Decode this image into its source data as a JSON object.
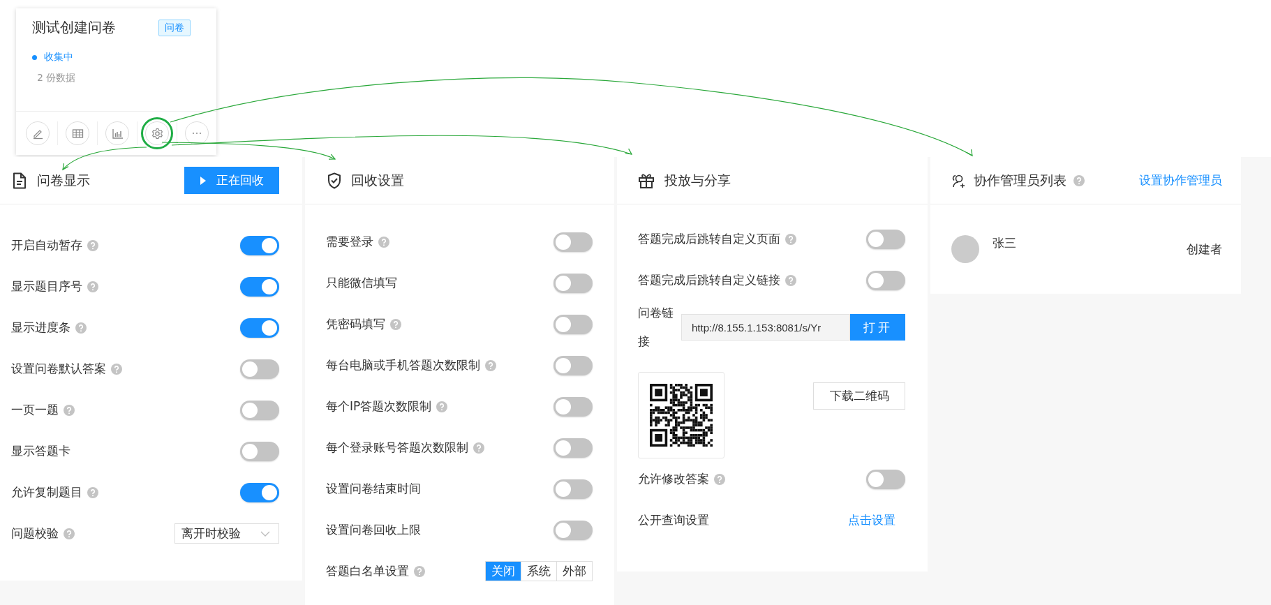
{
  "card": {
    "title": "测试创建问卷",
    "tag": "问卷",
    "status": "收集中",
    "count": "2 份数据",
    "actions": [
      {
        "kind": "edit",
        "highlighted": false
      },
      {
        "kind": "table",
        "highlighted": false
      },
      {
        "kind": "chart",
        "highlighted": false
      },
      {
        "kind": "settings",
        "highlighted": true
      },
      {
        "kind": "more",
        "highlighted": false
      }
    ]
  },
  "display_panel": {
    "title": "问卷显示",
    "button": "正在回收",
    "settings": [
      {
        "kind": "switch",
        "label": "开启自动暂存",
        "help": true,
        "on": true
      },
      {
        "kind": "switch",
        "label": "显示题目序号",
        "help": true,
        "on": true
      },
      {
        "kind": "switch",
        "label": "显示进度条",
        "help": true,
        "on": true
      },
      {
        "kind": "switch",
        "label": "设置问卷默认答案",
        "help": true,
        "on": false
      },
      {
        "kind": "switch",
        "label": "一页一题",
        "help": true,
        "on": false
      },
      {
        "kind": "switch",
        "label": "显示答题卡",
        "help": false,
        "on": false
      },
      {
        "kind": "switch",
        "label": "允许复制题目",
        "help": true,
        "on": true
      },
      {
        "kind": "select",
        "label": "问题校验",
        "help": true,
        "value": "离开时校验"
      }
    ]
  },
  "collection_panel": {
    "title": "回收设置",
    "settings": [
      {
        "kind": "switch",
        "label": "需要登录",
        "help": true,
        "on": false
      },
      {
        "kind": "switch",
        "label": "只能微信填写",
        "help": false,
        "on": false
      },
      {
        "kind": "switch",
        "label": "凭密码填写",
        "help": true,
        "on": false
      },
      {
        "kind": "switch",
        "label": "每台电脑或手机答题次数限制",
        "help": true,
        "on": false
      },
      {
        "kind": "switch",
        "label": "每个IP答题次数限制",
        "help": true,
        "on": false
      },
      {
        "kind": "switch",
        "label": "每个登录账号答题次数限制",
        "help": true,
        "on": false
      },
      {
        "kind": "switch",
        "label": "设置问卷结束时间",
        "help": false,
        "on": false
      },
      {
        "kind": "switch",
        "label": "设置问卷回收上限",
        "help": false,
        "on": false
      },
      {
        "kind": "segmented",
        "label": "答题白名单设置",
        "help": true,
        "options": [
          {
            "label": "关闭",
            "selected": true
          },
          {
            "label": "系统",
            "selected": false
          },
          {
            "label": "外部",
            "selected": false
          }
        ]
      }
    ]
  },
  "share_panel": {
    "title": "投放与分享",
    "settings": [
      {
        "kind": "switch",
        "label": "答题完成后跳转自定义页面",
        "help": true,
        "on": false
      },
      {
        "kind": "switch",
        "label": "答题完成后跳转自定义链接",
        "help": true,
        "on": false
      },
      {
        "kind": "link",
        "label": "问卷链接",
        "value": "http://8.155.1.153:8081/s/Yr",
        "button": "打开"
      },
      {
        "kind": "qr",
        "button": "下载二维码"
      },
      {
        "kind": "switch",
        "label": "允许修改答案",
        "help": true,
        "on": false
      },
      {
        "kind": "action",
        "label": "公开查询设置",
        "link": "点击设置"
      }
    ]
  },
  "admin_panel": {
    "title": "协作管理员列表",
    "help": true,
    "link": "设置协作管理员",
    "members": [
      {
        "name": "张三",
        "role": "创建者"
      }
    ]
  }
}
